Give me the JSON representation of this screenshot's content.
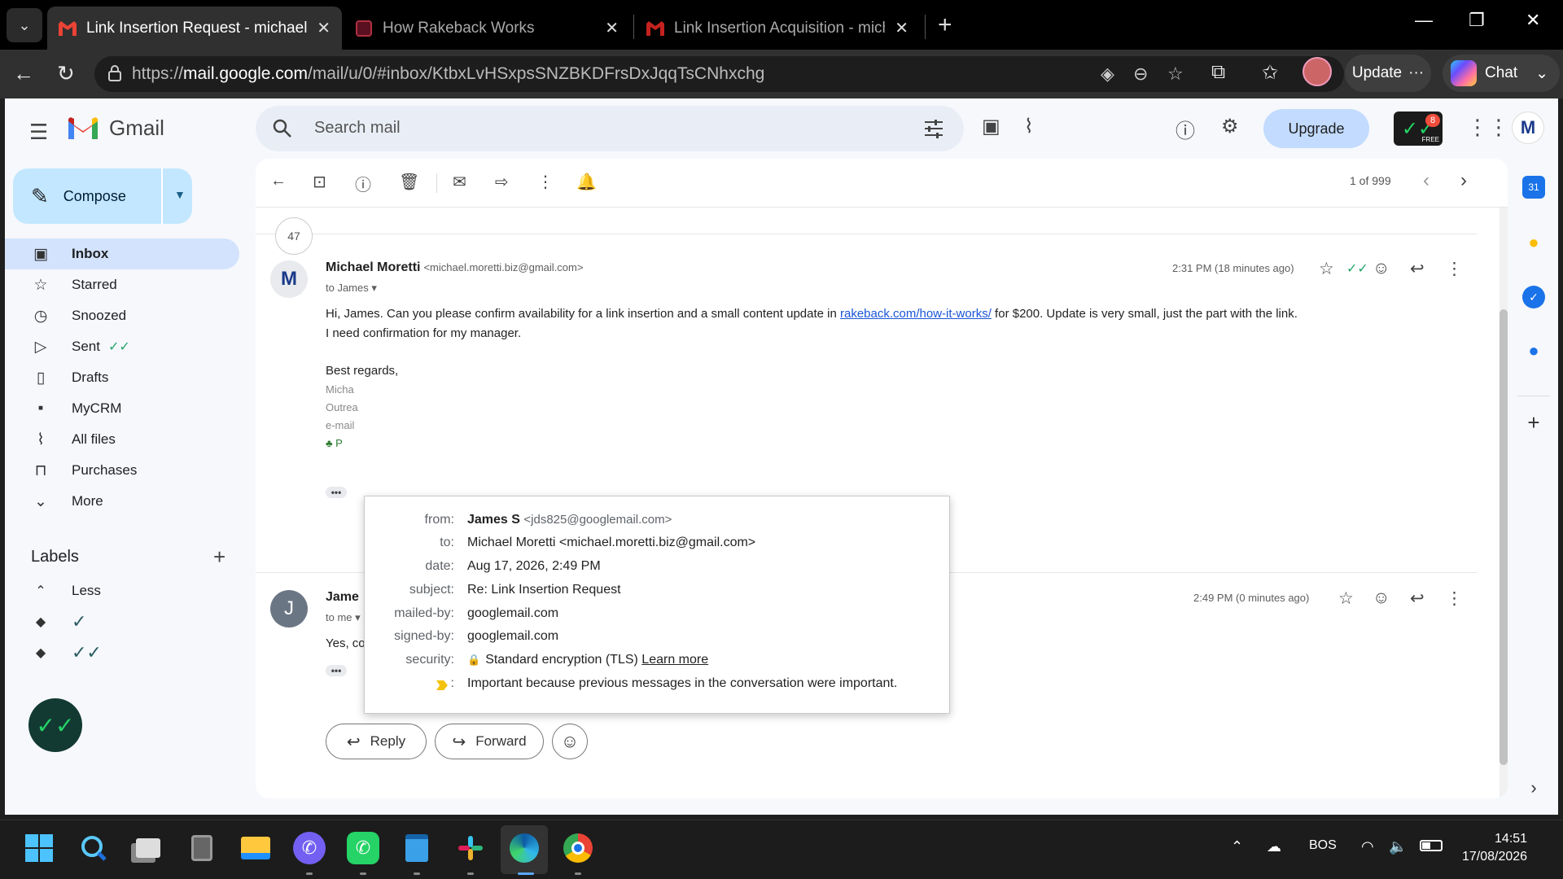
{
  "browser": {
    "tabs": [
      {
        "title": "Link Insertion Request - michael.m",
        "active": true
      },
      {
        "title": "How Rakeback Works",
        "active": false
      },
      {
        "title": "Link Insertion Acquisition - michae",
        "active": false
      }
    ],
    "url_prefix": "https://",
    "url_host": "mail.google.com",
    "url_path": "/mail/u/0/#inbox/KtbxLvHSxpsSNZBKDFrsDxJqqTsCNhxchg",
    "update_label": "Update",
    "chat_label": "Chat"
  },
  "gmail": {
    "brand": "Gmail",
    "search_placeholder": "Search mail",
    "upgrade_label": "Upgrade",
    "ext_badge_count": "8",
    "ext_badge_text": "FREE",
    "user_initial": "M",
    "compose_label": "Compose",
    "nav": [
      {
        "label": "Inbox",
        "icon": "inbox-icon",
        "glyph": "▣"
      },
      {
        "label": "Starred",
        "icon": "star-icon",
        "glyph": "☆"
      },
      {
        "label": "Snoozed",
        "icon": "clock-icon",
        "glyph": "◷"
      },
      {
        "label": "Sent",
        "icon": "send-icon",
        "glyph": "▷"
      },
      {
        "label": "Drafts",
        "icon": "draft-icon",
        "glyph": "▯"
      },
      {
        "label": "MyCRM",
        "icon": "contact-card-icon",
        "glyph": "▪"
      },
      {
        "label": "All files",
        "icon": "paperclip-icon",
        "glyph": "⌇"
      },
      {
        "label": "Purchases",
        "icon": "bag-icon",
        "glyph": "⊓"
      },
      {
        "label": "More",
        "icon": "chevron-down-icon",
        "glyph": "⌄"
      }
    ],
    "labels_title": "Labels",
    "labels": [
      {
        "label": "Less",
        "glyph": "⌃"
      },
      {
        "label": "✓",
        "glyph": "◆"
      },
      {
        "label": "✓✓",
        "glyph": "◆"
      }
    ]
  },
  "thread": {
    "pager": "1 of 999",
    "collapsed_count": "47",
    "messages": [
      {
        "avatar": "M",
        "avatar_color": "#5f6a78",
        "sender_name": "Michael Moretti",
        "sender_email": "<michael.moretti.biz@gmail.com>",
        "to": "to James",
        "time": "2:31 PM (18 minutes ago)",
        "body_line1_pre": "Hi, James. Can you please confirm availability for a link insertion and a small content update in ",
        "body_link": "rakeback.com/how-it-works/",
        "body_line1_post": " for $200. Update is very small, just the part with the link.",
        "body_line2": "I need confirmation for my manager.",
        "body_line3": "Best regards,",
        "sig_line1": "Micha",
        "sig_line2": "Outrea",
        "sig_line3": "e-mail",
        "sig_line4": "P"
      },
      {
        "avatar": "J",
        "avatar_color": "#6b7685",
        "sender_name": "Jame",
        "to": "to me",
        "time": "2:49 PM (0 minutes ago)",
        "body": "Yes, confirmed."
      }
    ],
    "reply_label": "Reply",
    "forward_label": "Forward"
  },
  "details_popup": {
    "rows": [
      {
        "key": "from:",
        "name": "James S",
        "value": "<jds825@googlemail.com>"
      },
      {
        "key": "to:",
        "value": "Michael Moretti <michael.moretti.biz@gmail.com>"
      },
      {
        "key": "date:",
        "value": "Aug 17, 2026, 2:49 PM"
      },
      {
        "key": "subject:",
        "value": "Re: Link Insertion Request"
      },
      {
        "key": "mailed-by:",
        "value": "googlemail.com"
      },
      {
        "key": "signed-by:",
        "value": "googlemail.com"
      },
      {
        "key": "security:",
        "value": "Standard encryption (TLS)",
        "link": "Learn more"
      },
      {
        "key": ":",
        "value": "Important because previous messages in the conversation were important."
      }
    ]
  },
  "taskbar": {
    "lang": "BOS",
    "time": "14:51",
    "date": "17/08/2026"
  },
  "colors": {
    "accent": "#0b57d0",
    "compose_bg": "#c2e7ff",
    "inbox_active": "#d3e3fd",
    "upgrade_bg": "#c2dbff",
    "link": "#1a55d6",
    "important": "#f4c20d"
  }
}
